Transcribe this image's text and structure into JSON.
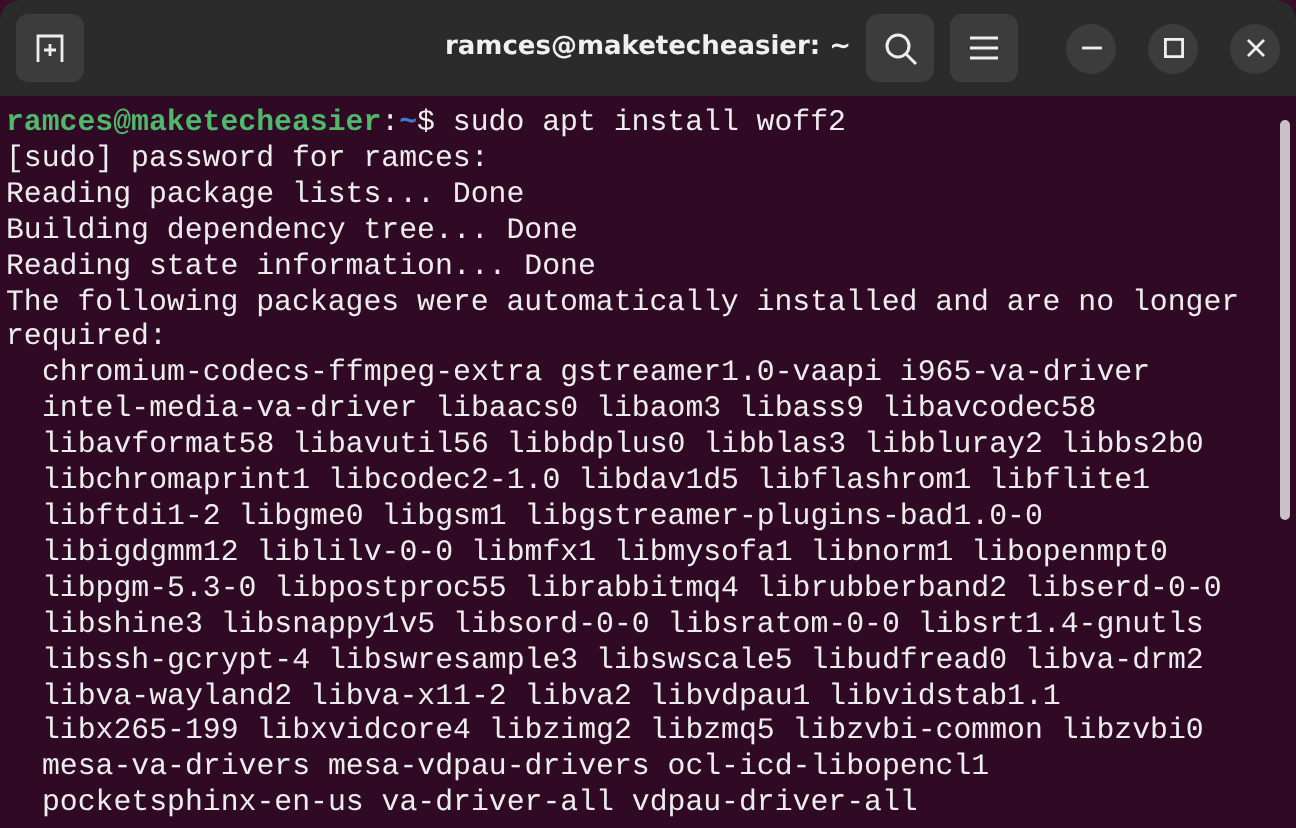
{
  "window": {
    "title": "ramces@maketecheasier: ~"
  },
  "prompt": {
    "user": "ramces@maketecheasier",
    "separator": ":",
    "path": "~",
    "command": "$ sudo apt install woff2"
  },
  "lines": [
    {
      "kind": "output",
      "text": "[sudo] password for ramces:"
    },
    {
      "kind": "output",
      "text": "Reading package lists... Done"
    },
    {
      "kind": "output",
      "text": "Building dependency tree... Done"
    },
    {
      "kind": "output",
      "text": "Reading state information... Done"
    },
    {
      "kind": "output",
      "text": "The following packages were automatically installed and are no longer"
    },
    {
      "kind": "output",
      "text": "required:"
    },
    {
      "kind": "package",
      "text": "chromium-codecs-ffmpeg-extra gstreamer1.0-vaapi i965-va-driver"
    },
    {
      "kind": "package",
      "text": "intel-media-va-driver libaacs0 libaom3 libass9 libavcodec58"
    },
    {
      "kind": "package",
      "text": "libavformat58 libavutil56 libbdplus0 libblas3 libbluray2 libbs2b0"
    },
    {
      "kind": "package",
      "text": "libchromaprint1 libcodec2-1.0 libdav1d5 libflashrom1 libflite1"
    },
    {
      "kind": "package",
      "text": "libftdi1-2 libgme0 libgsm1 libgstreamer-plugins-bad1.0-0"
    },
    {
      "kind": "package",
      "text": "libigdgmm12 liblilv-0-0 libmfx1 libmysofa1 libnorm1 libopenmpt0"
    },
    {
      "kind": "package",
      "text": "libpgm-5.3-0 libpostproc55 librabbitmq4 librubberband2 libserd-0-0"
    },
    {
      "kind": "package",
      "text": "libshine3 libsnappy1v5 libsord-0-0 libsratom-0-0 libsrt1.4-gnutls"
    },
    {
      "kind": "package",
      "text": "libssh-gcrypt-4 libswresample3 libswscale5 libudfread0 libva-drm2"
    },
    {
      "kind": "package",
      "text": "libva-wayland2 libva-x11-2 libva2 libvdpau1 libvidstab1.1"
    },
    {
      "kind": "package",
      "text": "libx265-199 libxvidcore4 libzimg2 libzmq5 libzvbi-common libzvbi0"
    },
    {
      "kind": "package",
      "text": "mesa-va-drivers mesa-vdpau-drivers ocl-icd-libopencl1"
    },
    {
      "kind": "package",
      "text": "pocketsphinx-en-us va-driver-all vdpau-driver-all"
    }
  ]
}
